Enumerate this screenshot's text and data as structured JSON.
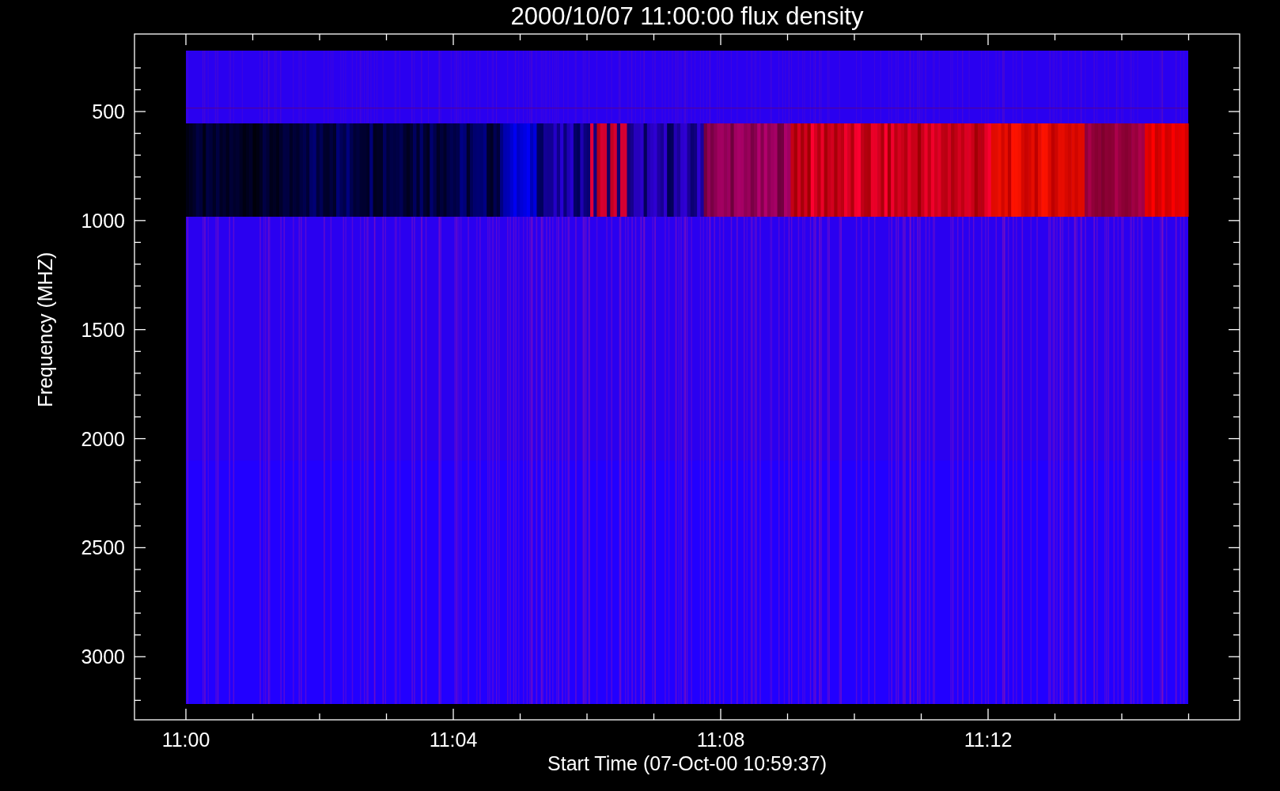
{
  "title": "2000/10/07 11:00:00 flux density",
  "y_axis": {
    "label": "Frequency (MHZ)",
    "ticks": [
      "500",
      "1000",
      "1500",
      "2000",
      "2500",
      "3000"
    ]
  },
  "x_axis": {
    "label": "Start Time (07-Oct-00 10:59:37)",
    "ticks": [
      "11:00",
      "11:04",
      "11:08",
      "11:12"
    ]
  }
}
